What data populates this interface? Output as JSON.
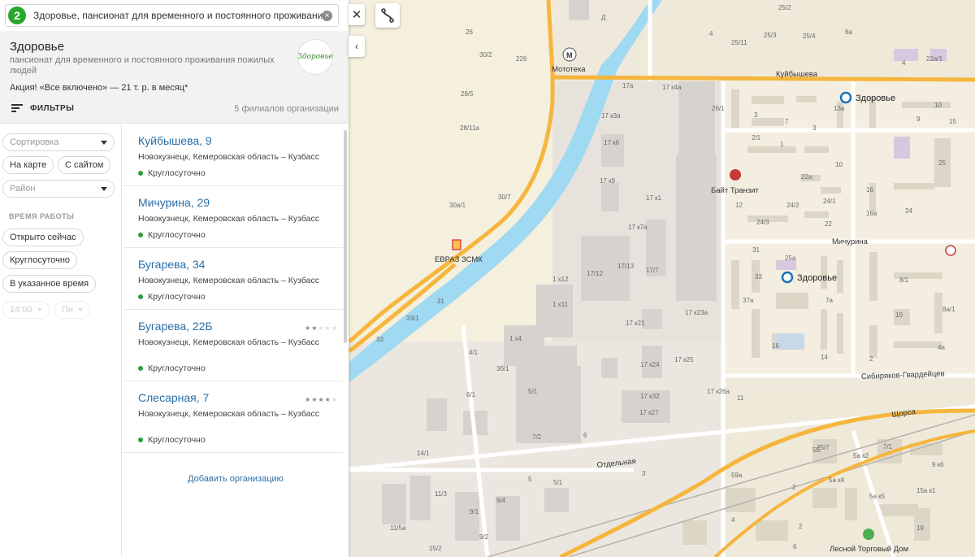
{
  "search": {
    "logo": "2",
    "query": "Здоровье, пансионат для временного и постоянного проживания по",
    "clear_icon": "×"
  },
  "org": {
    "name": "Здоровье",
    "subtitle": "пансионат для временного и постоянного проживания пожилых людей",
    "promo": "Акция! «Все включено» — 21 т. р. в месяц*",
    "logo_text": "Здоровье",
    "filters_label": "ФИЛЬТРЫ",
    "branches_count": "5 филиалов организации"
  },
  "filters": {
    "sort_placeholder": "Сортировка",
    "on_map": "На карте",
    "with_site": "С сайтом",
    "district_placeholder": "Район",
    "hours_heading": "ВРЕМЯ РАБОТЫ",
    "open_now": "Открыто сейчас",
    "around_clock": "Круглосуточно",
    "specified_time": "В указанное время",
    "time_value": "14:00",
    "day_value": "Пн"
  },
  "results": [
    {
      "title": "Куйбышева, 9",
      "address": "Новокузнецк, Кемеровская область – Кузбасс",
      "hours": "Круглосуточно",
      "rating": 0
    },
    {
      "title": "Мичурина, 29",
      "address": "Новокузнецк, Кемеровская область – Кузбасс",
      "hours": "Круглосуточно",
      "rating": 0
    },
    {
      "title": "Бугарева, 34",
      "address": "Новокузнецк, Кемеровская область – Кузбасс",
      "hours": "Круглосуточно",
      "rating": 0
    },
    {
      "title": "Бугарева, 22Б",
      "address": "Новокузнецк, Кемеровская область – Кузбасс",
      "hours": "Круглосуточно",
      "rating": 2
    },
    {
      "title": "Слесарная, 7",
      "address": "Новокузнецк, Кемеровская область – Кузбасс",
      "hours": "Круглосуточно",
      "rating": 4
    }
  ],
  "add_org": "Добавить организацию",
  "controls": {
    "close_icon": "✕",
    "collapse_icon": "‹"
  },
  "map": {
    "streets": [
      "Куйбышева",
      "Мичурина",
      "Сибиряков-Гвардейцев",
      "Щорса",
      "Отдельная"
    ],
    "pois": [
      "Мототека",
      "ЕВРАЗ ЗСМК",
      "Байт Транзит",
      "Лесной Торговый Дом"
    ],
    "markers": [
      "Здоровье",
      "Здоровье"
    ],
    "buildings": [
      "26",
      "30/2",
      "22б",
      "28/5",
      "28/11а",
      "30а/1",
      "30/7",
      "31",
      "33/1",
      "33",
      "4/1",
      "3б/1",
      "6/1",
      "5/1",
      "14/1",
      "11/3",
      "11/5а",
      "9/4",
      "9/1",
      "9/2",
      "15/2",
      "5",
      "3",
      "7/2",
      "6",
      "5/1",
      "1 х12",
      "1 х11",
      "1 х4",
      "17а",
      "17 к4а",
      "17 к3а",
      "17 к6",
      "17 к9",
      "17 к1",
      "17 к7а",
      "17/13",
      "17/12",
      "17/7",
      "17 к23а",
      "17 к21",
      "17 к24",
      "17 к25",
      "17 к26а",
      "17 к32",
      "17 к27",
      "26/1",
      "22а",
      "2/1",
      "24/2",
      "24/1",
      "24/3",
      "22",
      "13а",
      "3",
      "7",
      "10",
      "16",
      "16а",
      "24",
      "25",
      "15",
      "9",
      "3",
      "1",
      "12",
      "10",
      "31",
      "25а",
      "33",
      "37а",
      "7а",
      "8/1",
      "8а/1",
      "4а",
      "10",
      "16",
      "14",
      "2",
      "25/7",
      "25/2",
      "25/3",
      "25/4",
      "25/11",
      "6а",
      "4",
      "22а/1",
      "11",
      "5Б",
      "7/1",
      "5а к2",
      "9 к6",
      "5а к4",
      "5а к5",
      "15а к1",
      "19",
      "59а",
      "4",
      "2",
      "6",
      "2",
      "4",
      "Д"
    ]
  }
}
